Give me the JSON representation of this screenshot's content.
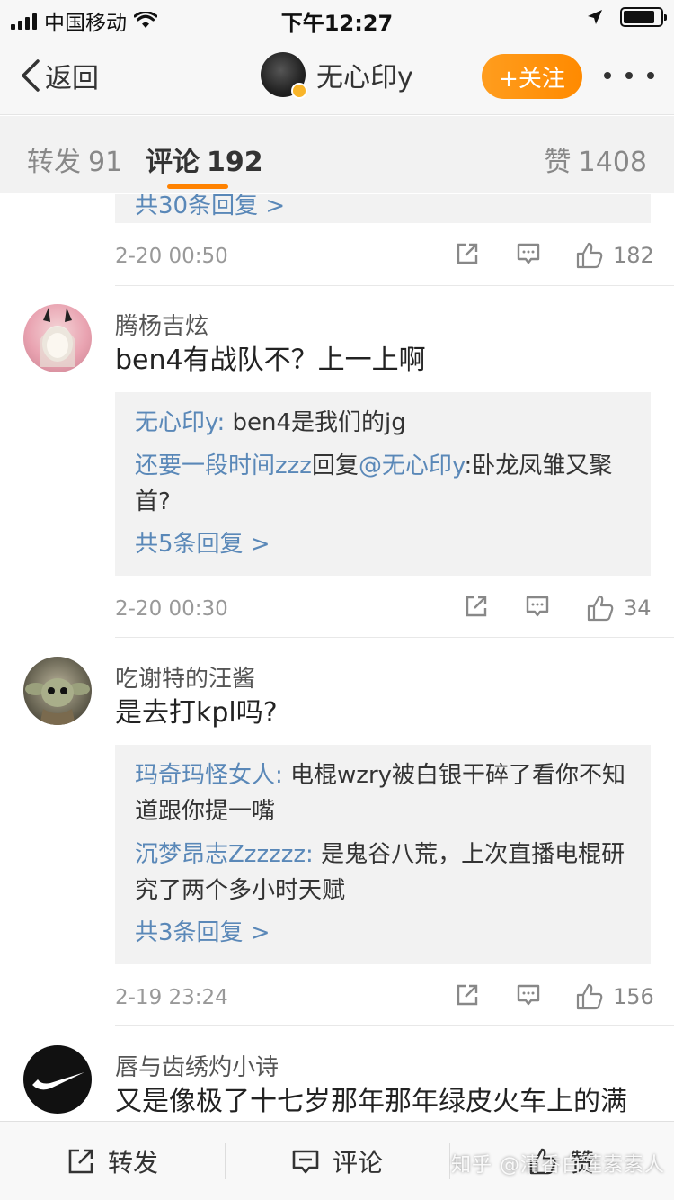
{
  "status_bar": {
    "carrier": "中国移动",
    "time": "下午12:27",
    "battery_level": 0.85
  },
  "nav": {
    "back_label": "返回",
    "user_name": "无心印y",
    "follow_label": "+关注",
    "accent_color": "#ff8200"
  },
  "tabs": [
    {
      "label": "转发",
      "count": "91"
    },
    {
      "label": "评论",
      "count": "192"
    },
    {
      "label": "赞",
      "count": "1408"
    }
  ],
  "partial_comment": {
    "more_replies": "共30条回复 >",
    "time": "2-20 00:50",
    "likes": "182"
  },
  "comments": [
    {
      "name": "腾杨吉炫",
      "text": "ben4有战队不？上一上啊",
      "replies": [
        {
          "who": "无心印y:",
          "text": " ben4是我们的jg"
        },
        {
          "who": "还要一段时间zzz",
          "mid": "回复",
          "mention": "@无心印y",
          "text": ":卧龙凤雏又聚首?"
        }
      ],
      "more_replies": "共5条回复 >",
      "time": "2-20 00:30",
      "likes": "34"
    },
    {
      "name": "吃谢特的汪酱",
      "text": "是去打kpl吗?",
      "replies": [
        {
          "who": "玛奇玛怪女人:",
          "text": " 电棍wzry被白银干碎了看你不知道跟你提一嘴"
        },
        {
          "who": "沉梦昂志Zzzzzz:",
          "text": " 是鬼谷八荒，上次直播电棍研究了两个多小时天赋"
        }
      ],
      "more_replies": "共3条回复 >",
      "time": "2-19 23:24",
      "likes": "156"
    },
    {
      "name": "唇与齿绣灼小诗",
      "text": "又是像极了十七岁那年那年绿皮火车上的满"
    }
  ],
  "bottom_bar": {
    "repost_label": "转发",
    "comment_label": "评论",
    "like_label": "赞",
    "watermark": "知乎 @清香白莲素素人"
  },
  "icons": [
    "back-chevron-icon",
    "verified-badge-icon",
    "more-icon",
    "share-icon",
    "comment-icon",
    "like-icon",
    "repost-icon"
  ]
}
